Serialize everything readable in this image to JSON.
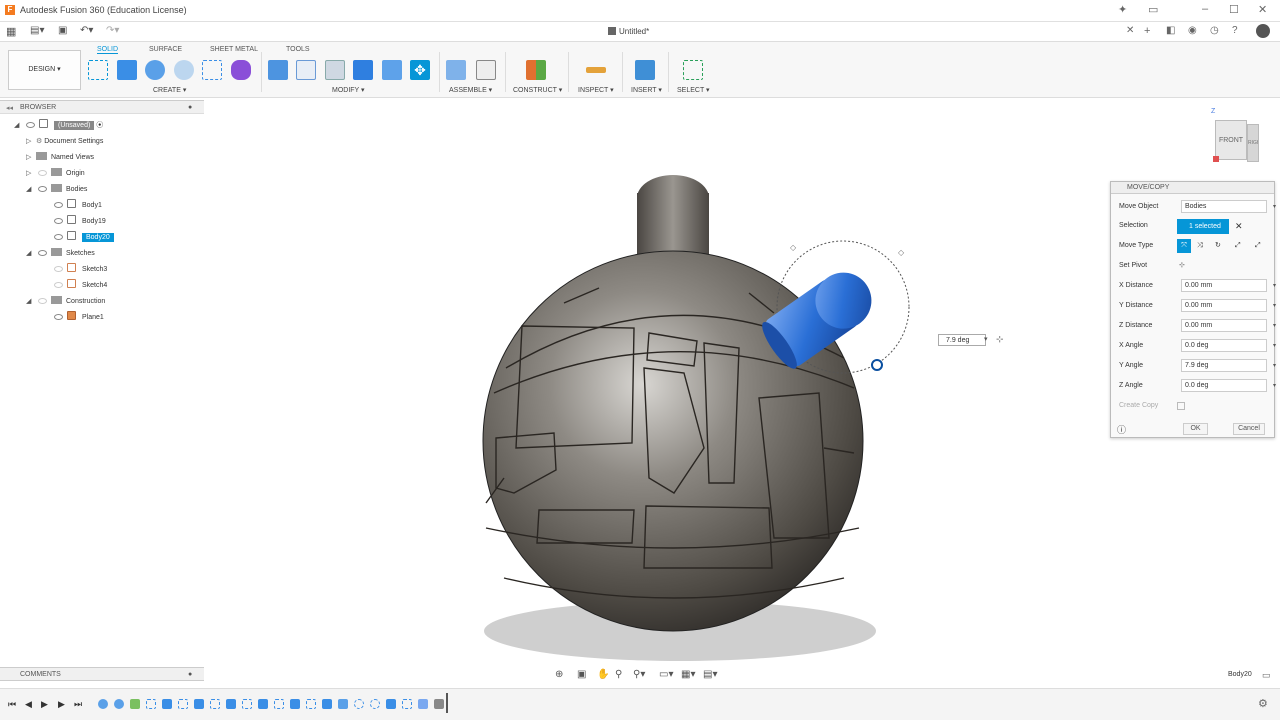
{
  "app": {
    "title": "Autodesk Fusion 360 (Education License)",
    "document_tab": "Untitled*"
  },
  "toolbar": {
    "workspace": "DESIGN ▾",
    "tabs": [
      "SOLID",
      "SURFACE",
      "SHEET METAL",
      "TOOLS"
    ],
    "groups": [
      "CREATE ▾",
      "MODIFY ▾",
      "ASSEMBLE ▾",
      "CONSTRUCT ▾",
      "INSPECT ▾",
      "INSERT ▾",
      "SELECT ▾"
    ]
  },
  "browser": {
    "title": "BROWSER",
    "items": [
      "(Unsaved)",
      "Document Settings",
      "Named Views",
      "Origin",
      "Bodies",
      "Body1",
      "Body19",
      "Body20",
      "Sketches",
      "Sketch3",
      "Sketch4",
      "Construction",
      "Plane1"
    ]
  },
  "viewcube": {
    "front": "FRONT",
    "right": "RIGHT",
    "axis": "Z"
  },
  "move_copy": {
    "title": "MOVE/COPY",
    "move_object_label": "Move Object",
    "move_object_value": "Bodies",
    "selection_label": "Selection",
    "selection_value": "1 selected",
    "move_type_label": "Move Type",
    "set_pivot_label": "Set Pivot",
    "x_distance_label": "X Distance",
    "x_distance_value": "0.00 mm",
    "y_distance_label": "Y Distance",
    "y_distance_value": "0.00 mm",
    "z_distance_label": "Z Distance",
    "z_distance_value": "0.00 mm",
    "x_angle_label": "X Angle",
    "x_angle_value": "0.0 deg",
    "y_angle_label": "Y Angle",
    "y_angle_value": "7.9 deg",
    "z_angle_label": "Z Angle",
    "z_angle_value": "0.0 deg",
    "create_copy_label": "Create Copy",
    "ok_label": "OK",
    "cancel_label": "Cancel"
  },
  "angle_input_value": "7.9 deg",
  "comments_label": "COMMENTS",
  "status_selected": "Body20",
  "colors": {
    "accent": "#0696d7",
    "blue_body": "#2a6fd6",
    "sphere": "#6f6a62"
  }
}
